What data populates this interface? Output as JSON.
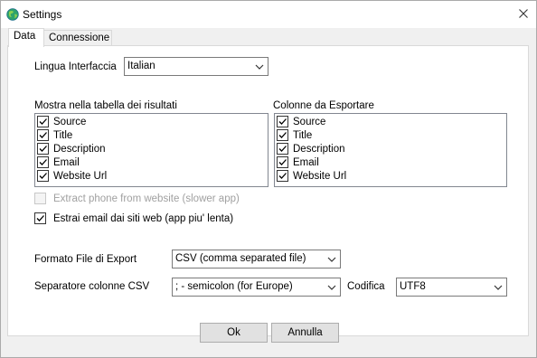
{
  "window": {
    "title": "Settings"
  },
  "tabs": [
    {
      "label": "Data"
    },
    {
      "label": "Connessione"
    }
  ],
  "language": {
    "label": "Lingua Interfaccia",
    "value": "Italian"
  },
  "results_table": {
    "label": "Mostra nella tabella dei risultati",
    "items": [
      {
        "label": "Source",
        "checked": true
      },
      {
        "label": "Title",
        "checked": true
      },
      {
        "label": "Description",
        "checked": true
      },
      {
        "label": "Email",
        "checked": true
      },
      {
        "label": "Website Url",
        "checked": true
      }
    ]
  },
  "export_columns": {
    "label": "Colonne da Esportare",
    "items": [
      {
        "label": "Source",
        "checked": true
      },
      {
        "label": "Title",
        "checked": true
      },
      {
        "label": "Description",
        "checked": true
      },
      {
        "label": "Email",
        "checked": true
      },
      {
        "label": "Website Url",
        "checked": true
      }
    ]
  },
  "options": {
    "extract_phone": {
      "label": "Extract phone from website (slower app)",
      "checked": false,
      "enabled": false
    },
    "extract_email": {
      "label": "Estrai email dai siti web (app piu' lenta)",
      "checked": true,
      "enabled": true
    }
  },
  "export_format": {
    "label": "Formato File di Export",
    "value": "CSV (comma separated file)"
  },
  "separator": {
    "label": "Separatore colonne CSV",
    "value": "; - semicolon (for Europe)"
  },
  "encoding": {
    "label": "Codifica",
    "value": "UTF8"
  },
  "buttons": {
    "ok": "Ok",
    "cancel": "Annulla"
  }
}
